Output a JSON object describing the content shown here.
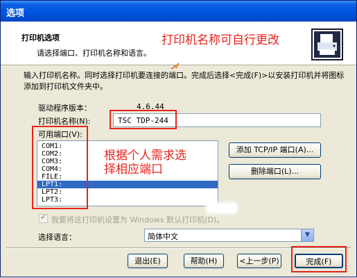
{
  "window": {
    "title": "选项"
  },
  "header": {
    "title": "打印机选项",
    "subtitle": "请选择端口、打印机名称和语言。"
  },
  "annotations": {
    "name_tip": "打印机名称可自行更改",
    "port_tip_line1": "根据个人需求选",
    "port_tip_line2": "择相应端口"
  },
  "description": "输入打印机名称。同时选择打印机要连接的端口。完成后选择<完成(F)>以安装打印机并将图标添加到打印机文件夹中。",
  "driver": {
    "label": "驱动程序版本：",
    "value": "4.6.44"
  },
  "printer_name": {
    "label": "打印机名称(N):",
    "value": "TSC  TDP-244"
  },
  "ports": {
    "label": "可用端口(V):",
    "items": [
      "COM1:",
      "COM2:",
      "COM3:",
      "COM4:",
      "FILE:",
      "LPT1:",
      "LPT2:",
      "LPT3:"
    ],
    "selected": "LPT1:"
  },
  "buttons": {
    "add_port": "添加 TCP/IP 端口(A)...",
    "delete_port": "删除端口(L)...",
    "exit": "退出(E)",
    "help": "帮助(H)",
    "back": "<上一步(P)",
    "finish": "完成(F)"
  },
  "default_printer": {
    "label": "我要将这打印机设置为 Windows 默认打印机(D)。",
    "checked": true
  },
  "language": {
    "label": "选择语言：",
    "value": "简体中文"
  },
  "colors": {
    "annotation_red": "#e8231c",
    "selection_blue": "#316ac5",
    "titlebar_blue": "#0054e3"
  }
}
